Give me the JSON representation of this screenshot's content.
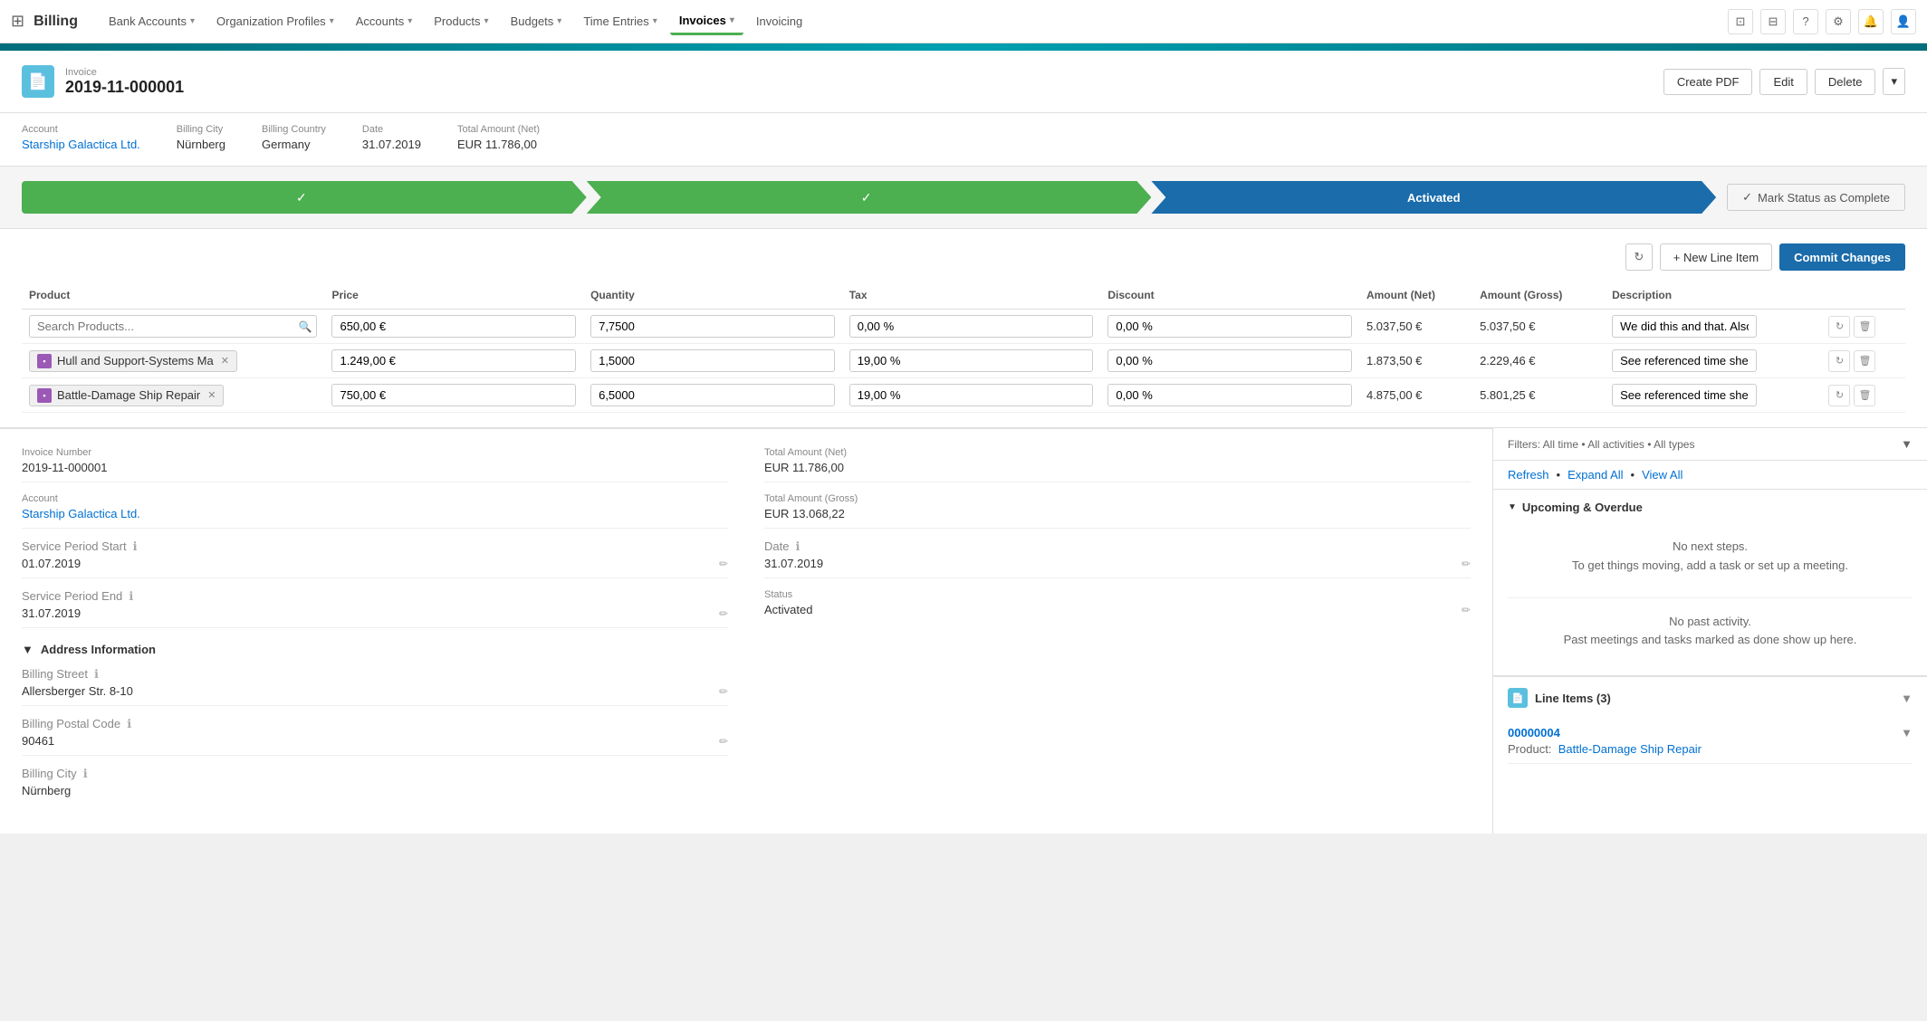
{
  "app": {
    "title": "Billing",
    "grid_icon": "⊞"
  },
  "nav": {
    "items": [
      {
        "id": "bank-accounts",
        "label": "Bank Accounts",
        "has_chevron": true
      },
      {
        "id": "org-profiles",
        "label": "Organization Profiles",
        "has_chevron": true
      },
      {
        "id": "accounts",
        "label": "Accounts",
        "has_chevron": true
      },
      {
        "id": "products",
        "label": "Products",
        "has_chevron": true
      },
      {
        "id": "budgets",
        "label": "Budgets",
        "has_chevron": true
      },
      {
        "id": "time-entries",
        "label": "Time Entries",
        "has_chevron": true
      },
      {
        "id": "invoices",
        "label": "Invoices",
        "has_chevron": true,
        "active": true
      },
      {
        "id": "invoicing",
        "label": "Invoicing",
        "has_chevron": false
      }
    ]
  },
  "invoice": {
    "label": "Invoice",
    "number": "2019-11-000001",
    "buttons": {
      "create_pdf": "Create PDF",
      "edit": "Edit",
      "delete": "Delete"
    },
    "meta": {
      "account_label": "Account",
      "account_value": "Starship Galactica Ltd.",
      "billing_city_label": "Billing City",
      "billing_city_value": "Nürnberg",
      "billing_country_label": "Billing Country",
      "billing_country_value": "Germany",
      "date_label": "Date",
      "date_value": "31.07.2019",
      "total_amount_label": "Total Amount (Net)",
      "total_amount_value": "EUR 11.786,00"
    }
  },
  "status": {
    "steps": [
      "",
      "",
      "Activated"
    ],
    "mark_complete_label": "Mark Status as Complete",
    "check_icon": "✓"
  },
  "line_items": {
    "toolbar": {
      "new_line_item_label": "+ New Line Item",
      "commit_label": "Commit Changes",
      "refresh_icon": "↻"
    },
    "table": {
      "columns": [
        "Product",
        "Price",
        "Quantity",
        "Tax",
        "Discount",
        "Amount (Net)",
        "Amount (Gross)",
        "Description"
      ],
      "rows": [
        {
          "product": "",
          "product_is_search": true,
          "price": "650,00 €",
          "quantity": "7,7500",
          "tax": "0,00 %",
          "discount": "0,00 %",
          "amount_net": "5.037,50 €",
          "amount_gross": "5.037,50 €",
          "description": "We did this and that. Also some"
        },
        {
          "product": "Hull and Support-Systems Ma",
          "product_is_search": false,
          "price": "1.249,00 €",
          "quantity": "1,5000",
          "tax": "19,00 %",
          "discount": "0,00 %",
          "amount_net": "1.873,50 €",
          "amount_gross": "2.229,46 €",
          "description": "See referenced time sheet for d"
        },
        {
          "product": "Battle-Damage Ship Repair",
          "product_is_search": false,
          "price": "750,00 €",
          "quantity": "6,5000",
          "tax": "19,00 %",
          "discount": "0,00 %",
          "amount_net": "4.875,00 €",
          "amount_gross": "5.801,25 €",
          "description": "See referenced time sheet for d"
        }
      ]
    }
  },
  "details": {
    "invoice_number_label": "Invoice Number",
    "invoice_number_value": "2019-11-000001",
    "account_label": "Account",
    "account_value": "Starship Galactica Ltd.",
    "service_period_start_label": "Service Period Start",
    "service_period_start_value": "01.07.2019",
    "service_period_end_label": "Service Period End",
    "service_period_end_value": "31.07.2019",
    "address_section_label": "Address Information",
    "billing_street_label": "Billing Street",
    "billing_street_value": "Allersberger Str. 8-10",
    "billing_postal_label": "Billing Postal Code",
    "billing_postal_value": "90461",
    "billing_city_label": "Billing City",
    "billing_city_value": "Nürnberg",
    "total_net_label": "Total Amount (Net)",
    "total_net_value": "EUR 11.786,00",
    "total_gross_label": "Total Amount (Gross)",
    "total_gross_value": "EUR 13.068,22",
    "date_label": "Date",
    "date_value": "31.07.2019",
    "status_label": "Status",
    "status_value": "Activated"
  },
  "activity": {
    "filters_text": "Filters: All time • All activities • All types",
    "filter_icon": "▼",
    "actions": [
      "Refresh",
      "Expand All",
      "View All"
    ],
    "upcoming_label": "Upcoming & Overdue",
    "no_steps_line1": "No next steps.",
    "no_steps_line2": "To get things moving, add a task or set up a meeting.",
    "no_activity_line1": "No past activity.",
    "no_activity_line2": "Past meetings and tasks marked as done show up here."
  },
  "line_items_widget": {
    "title": "Line Items (3)",
    "entries": [
      {
        "number": "00000004",
        "product_label": "Product:",
        "product_value": "Battle-Damage Ship Repair"
      }
    ]
  }
}
